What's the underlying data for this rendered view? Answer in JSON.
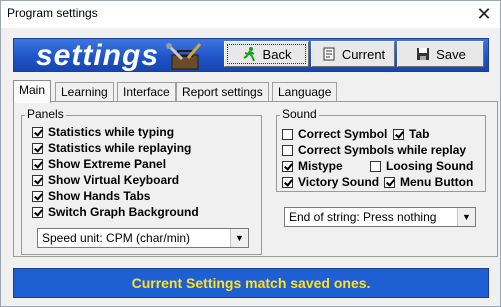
{
  "window": {
    "title": "Program settings",
    "close_glyph": "✕"
  },
  "header": {
    "logo_text": "settings",
    "back_label": "Back",
    "current_label": "Current",
    "save_label": "Save"
  },
  "tabs": [
    {
      "label": "Main",
      "active": true
    },
    {
      "label": "Learning",
      "active": false
    },
    {
      "label": "Interface",
      "active": false
    },
    {
      "label": "Report settings",
      "active": false
    },
    {
      "label": "Language",
      "active": false
    }
  ],
  "panels": {
    "label": "Panels",
    "items": [
      {
        "label": "Statistics while typing",
        "checked": true
      },
      {
        "label": "Statistics while replaying",
        "checked": true
      },
      {
        "label": "Show Extreme Panel",
        "checked": true
      },
      {
        "label": "Show Virtual Keyboard",
        "checked": true
      },
      {
        "label": "Show Hands Tabs",
        "checked": true
      },
      {
        "label": "Switch Graph Background",
        "checked": true
      }
    ],
    "speed_unit": "Speed unit: CPM (char/min)"
  },
  "sound": {
    "label": "Sound",
    "items": {
      "correct_symbol": {
        "label": "Correct Symbol",
        "checked": false
      },
      "tab": {
        "label": "Tab",
        "checked": true
      },
      "correct_symbols_replay": {
        "label": "Correct Symbols while replay",
        "checked": false
      },
      "mistype": {
        "label": "Mistype",
        "checked": true
      },
      "loosing_sound": {
        "label": "Loosing Sound",
        "checked": false
      },
      "victory_sound": {
        "label": "Victory Sound",
        "checked": true
      },
      "menu_button": {
        "label": "Menu Button",
        "checked": true
      }
    },
    "end_of_string": "End of string: Press nothing"
  },
  "status": {
    "text": "Current Settings match saved ones."
  },
  "colors": {
    "header_blue": "#1f55c9",
    "status_text": "#ffe21f",
    "status_bg": "#1f5fd4"
  }
}
